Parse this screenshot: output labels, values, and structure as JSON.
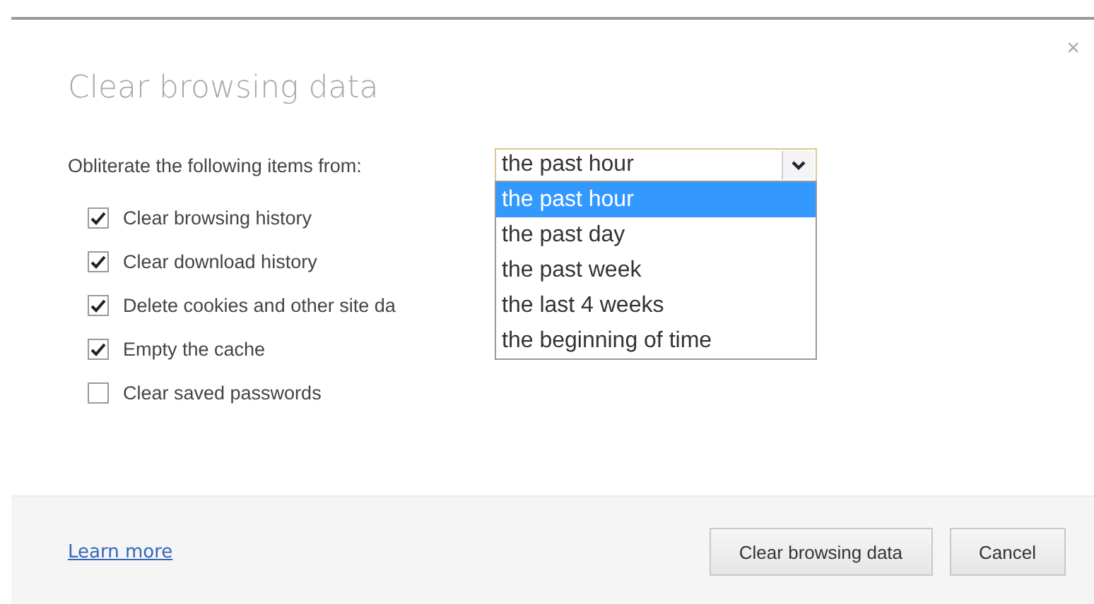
{
  "dialog": {
    "title": "Clear browsing data",
    "close": "×"
  },
  "period": {
    "label": "Obliterate the following items from:",
    "value": "the past hour",
    "expanded": true,
    "options": [
      {
        "label": "the past hour",
        "selected": true
      },
      {
        "label": "the past day",
        "selected": false
      },
      {
        "label": "the past week",
        "selected": false
      },
      {
        "label": "the last 4 weeks",
        "selected": false
      },
      {
        "label": "the beginning of time",
        "selected": false
      }
    ]
  },
  "items": [
    {
      "label": "Clear browsing history",
      "checked": true
    },
    {
      "label": "Clear download history",
      "checked": true
    },
    {
      "label": "Delete cookies and other site da",
      "checked": true
    },
    {
      "label": "Empty the cache",
      "checked": true
    },
    {
      "label": "Clear saved passwords",
      "checked": false
    }
  ],
  "footer": {
    "link": "Learn more",
    "buttons": [
      "Clear browsing data",
      "Cancel"
    ]
  }
}
